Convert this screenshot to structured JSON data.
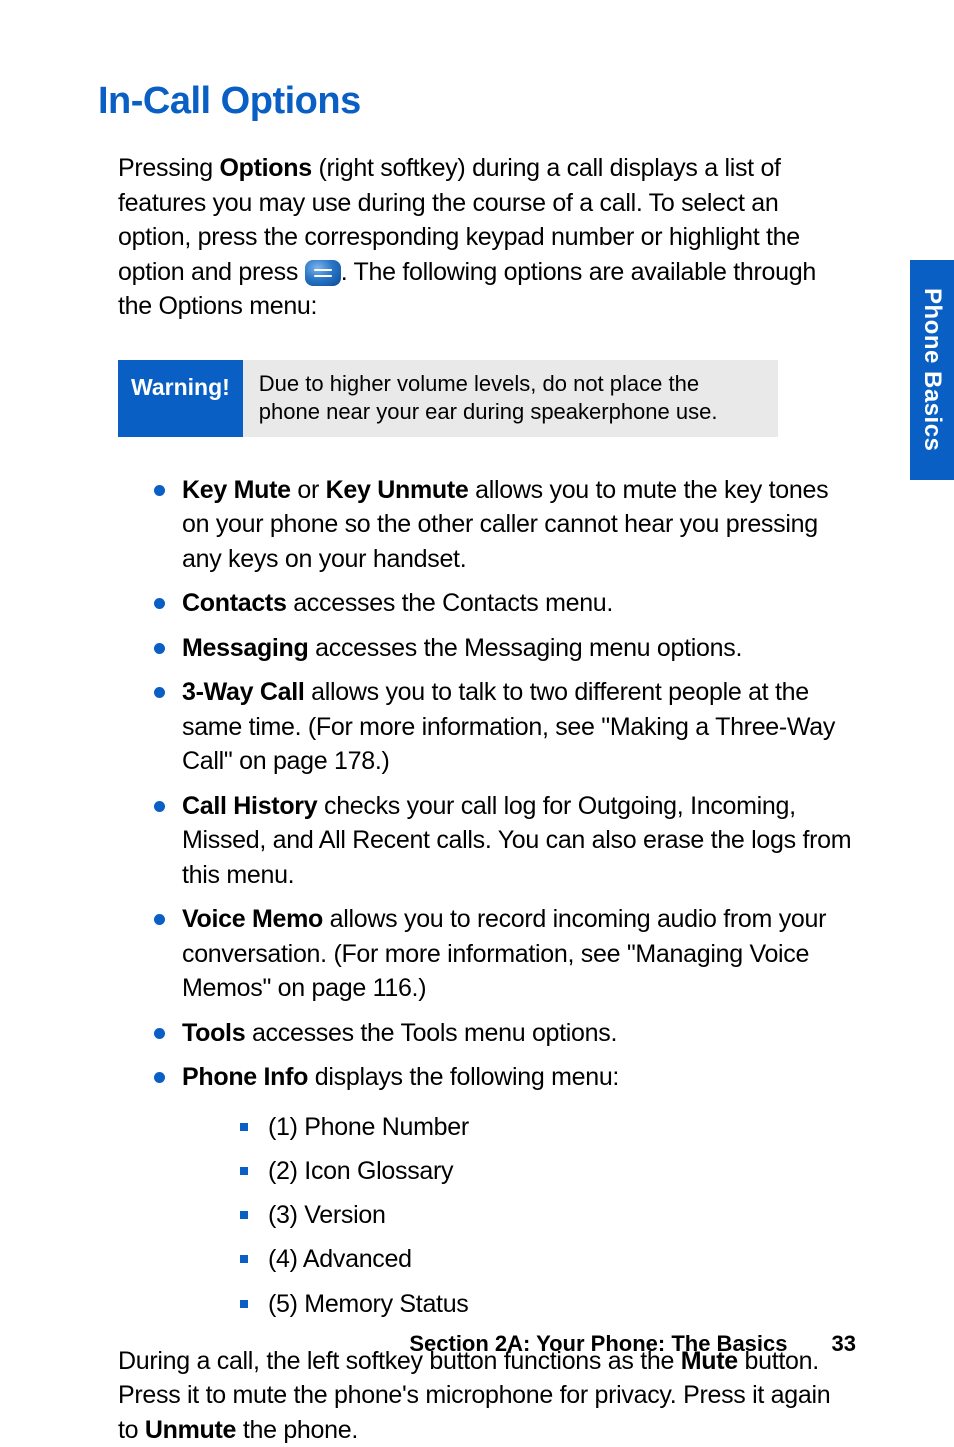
{
  "side_tab": "Phone Basics",
  "heading": "In-Call Options",
  "intro": {
    "part1": "Pressing ",
    "bold1": "Options",
    "part2": " (right softkey) during a call displays a list of features you may use during the course of a call. To select an option, press the corresponding keypad number or highlight the option and press ",
    "part3": ". The following options are available through the Options menu:"
  },
  "warning": {
    "label": "Warning!",
    "text": "Due to higher volume levels, do not place the phone near your ear during speakerphone use."
  },
  "bullets": [
    {
      "bold1": "Key Mute",
      "mid": " or ",
      "bold2": "Key Unmute",
      "rest": " allows you to mute the key tones on your phone so the other caller cannot hear you pressing any keys on your handset."
    },
    {
      "bold1": "Contacts",
      "rest": " accesses the Contacts menu."
    },
    {
      "bold1": "Messaging",
      "rest": " accesses the Messaging menu options."
    },
    {
      "bold1": "3-Way Call",
      "rest": " allows you to talk to two different people at the same time. (For more information, see \"Making a Three-Way Call\" on page 178.)"
    },
    {
      "bold1": "Call History",
      "rest": " checks your call log for Outgoing, Incoming, Missed, and All Recent calls. You can also erase the logs from this menu."
    },
    {
      "bold1": "Voice Memo",
      "rest": " allows you to record incoming audio from your conversation. (For more information, see \"Managing Voice Memos\" on page 116.)"
    },
    {
      "bold1": "Tools",
      "rest": " accesses the Tools menu options."
    },
    {
      "bold1": "Phone Info",
      "rest": " displays the following menu:"
    }
  ],
  "sub_items": [
    "(1) Phone Number",
    "(2) Icon Glossary",
    "(3) Version",
    "(4) Advanced",
    "(5) Memory Status"
  ],
  "closing": {
    "part1": "During a call, the left softkey button functions as the ",
    "bold1": "Mute",
    "part2": " button. Press it to mute the phone's microphone for privacy. Press it again to ",
    "bold2": "Unmute",
    "part3": " the phone."
  },
  "footer": {
    "section": "Section 2A: Your Phone: The Basics",
    "page": "33"
  }
}
